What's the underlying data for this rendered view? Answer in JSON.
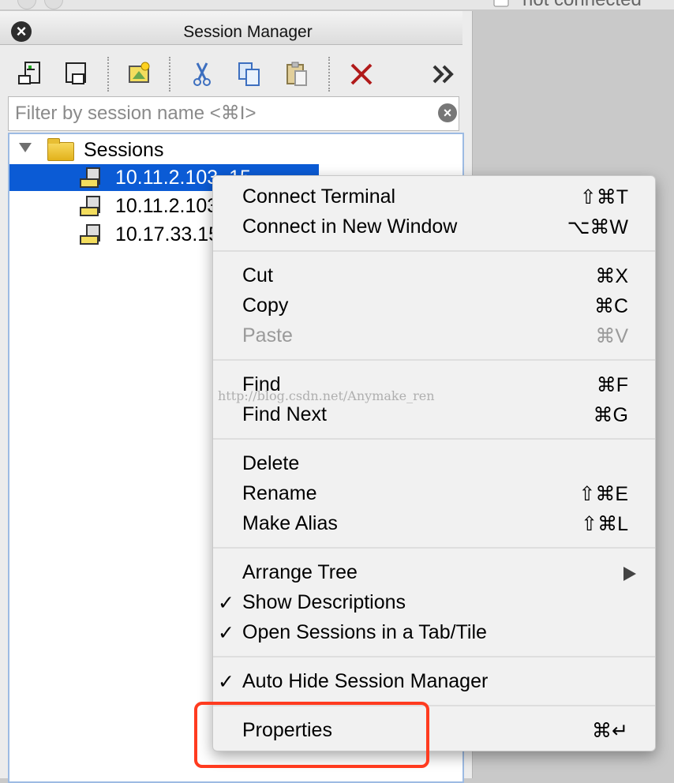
{
  "window": {
    "connection_status": "not connected"
  },
  "session_manager": {
    "title": "Session Manager",
    "toolbar": {
      "buttons": [
        {
          "name": "connect-icon"
        },
        {
          "name": "connect-new-window-icon"
        },
        {
          "name": "new-session-icon"
        },
        {
          "name": "cut-icon"
        },
        {
          "name": "copy-icon"
        },
        {
          "name": "paste-icon"
        },
        {
          "name": "delete-icon"
        },
        {
          "name": "more-chevron-icon"
        }
      ]
    },
    "filter": {
      "placeholder": "Filter by session name <⌘I>"
    },
    "tree": {
      "root_label": "Sessions",
      "sessions": [
        {
          "label": "10.11.2.103_15",
          "selected": true
        },
        {
          "label": "10.11.2.103",
          "selected": false
        },
        {
          "label": "10.17.33.15",
          "selected": false
        }
      ]
    }
  },
  "context_menu": {
    "items": {
      "connect_terminal": {
        "label": "Connect Terminal",
        "shortcut": "⇧⌘T"
      },
      "connect_new_window": {
        "label": "Connect in New Window",
        "shortcut": "⌥⌘W"
      },
      "cut": {
        "label": "Cut",
        "shortcut": "⌘X"
      },
      "copy": {
        "label": "Copy",
        "shortcut": "⌘C"
      },
      "paste": {
        "label": "Paste",
        "shortcut": "⌘V",
        "disabled": true
      },
      "find": {
        "label": "Find",
        "shortcut": "⌘F"
      },
      "find_next": {
        "label": "Find Next",
        "shortcut": "⌘G"
      },
      "delete": {
        "label": "Delete",
        "shortcut": ""
      },
      "rename": {
        "label": "Rename",
        "shortcut": "⇧⌘E"
      },
      "make_alias": {
        "label": "Make Alias",
        "shortcut": "⇧⌘L"
      },
      "arrange_tree": {
        "label": "Arrange Tree",
        "submenu": true
      },
      "show_descriptions": {
        "label": "Show Descriptions",
        "checked": true
      },
      "open_sessions_tab": {
        "label": "Open Sessions in a Tab/Tile",
        "checked": true
      },
      "auto_hide": {
        "label": "Auto Hide Session Manager",
        "checked": true
      },
      "properties": {
        "label": "Properties",
        "shortcut": "⌘↵"
      }
    },
    "check_mark": "✓"
  },
  "watermark": "http://blog.csdn.net/Anymake_ren",
  "colors": {
    "selection": "#0b5bd5",
    "highlight_box": "#ff3b1f"
  }
}
